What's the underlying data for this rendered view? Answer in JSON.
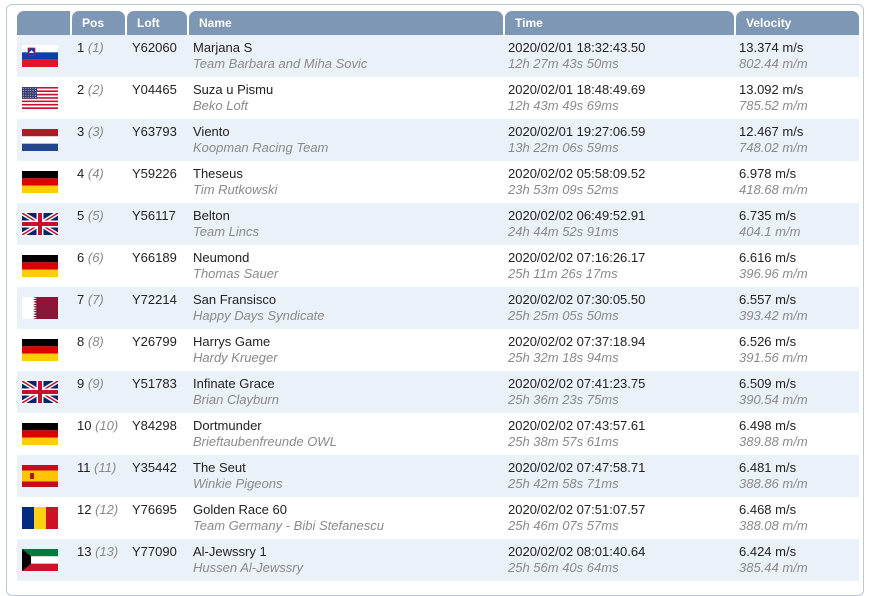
{
  "header": {
    "pos": "Pos",
    "loft": "Loft",
    "name": "Name",
    "time": "Time",
    "velocity": "Velocity"
  },
  "rows": [
    {
      "flag": "slovenia",
      "pos": "1",
      "pos_prev": "(1)",
      "loft": "Y62060",
      "name": "Marjana S",
      "team": "Team Barbara and Miha Sovic",
      "time": "2020/02/01 18:32:43.50",
      "duration": "12h 27m 43s 50ms",
      "velocity": "13.374 m/s",
      "velocity_min": "802.44 m/m"
    },
    {
      "flag": "usa",
      "pos": "2",
      "pos_prev": "(2)",
      "loft": "Y04465",
      "name": "Suza u Pismu",
      "team": "Beko Loft",
      "time": "2020/02/01 18:48:49.69",
      "duration": "12h 43m 49s 69ms",
      "velocity": "13.092 m/s",
      "velocity_min": "785.52 m/m"
    },
    {
      "flag": "netherlands",
      "pos": "3",
      "pos_prev": "(3)",
      "loft": "Y63793",
      "name": "Viento",
      "team": "Koopman Racing Team",
      "time": "2020/02/01 19:27:06.59",
      "duration": "13h 22m 06s 59ms",
      "velocity": "12.467 m/s",
      "velocity_min": "748.02 m/m"
    },
    {
      "flag": "germany",
      "pos": "4",
      "pos_prev": "(4)",
      "loft": "Y59226",
      "name": "Theseus",
      "team": "Tim Rutkowski",
      "time": "2020/02/02 05:58:09.52",
      "duration": "23h 53m 09s 52ms",
      "velocity": "6.978 m/s",
      "velocity_min": "418.68 m/m"
    },
    {
      "flag": "uk",
      "pos": "5",
      "pos_prev": "(5)",
      "loft": "Y56117",
      "name": "Belton",
      "team": "Team Lincs",
      "time": "2020/02/02 06:49:52.91",
      "duration": "24h 44m 52s 91ms",
      "velocity": "6.735 m/s",
      "velocity_min": "404.1 m/m"
    },
    {
      "flag": "germany",
      "pos": "6",
      "pos_prev": "(6)",
      "loft": "Y66189",
      "name": "Neumond",
      "team": "Thomas Sauer",
      "time": "2020/02/02 07:16:26.17",
      "duration": "25h 11m 26s 17ms",
      "velocity": "6.616 m/s",
      "velocity_min": "396.96 m/m"
    },
    {
      "flag": "qatar",
      "pos": "7",
      "pos_prev": "(7)",
      "loft": "Y72214",
      "name": "San Fransisco",
      "team": "Happy Days Syndicate",
      "time": "2020/02/02 07:30:05.50",
      "duration": "25h 25m 05s 50ms",
      "velocity": "6.557 m/s",
      "velocity_min": "393.42 m/m"
    },
    {
      "flag": "germany",
      "pos": "8",
      "pos_prev": "(8)",
      "loft": "Y26799",
      "name": "Harrys Game",
      "team": "Hardy Krueger",
      "time": "2020/02/02 07:37:18.94",
      "duration": "25h 32m 18s 94ms",
      "velocity": "6.526 m/s",
      "velocity_min": "391.56 m/m"
    },
    {
      "flag": "uk",
      "pos": "9",
      "pos_prev": "(9)",
      "loft": "Y51783",
      "name": "Infinate Grace",
      "team": "Brian Clayburn",
      "time": "2020/02/02 07:41:23.75",
      "duration": "25h 36m 23s 75ms",
      "velocity": "6.509 m/s",
      "velocity_min": "390.54 m/m"
    },
    {
      "flag": "germany",
      "pos": "10",
      "pos_prev": "(10)",
      "loft": "Y84298",
      "name": "Dortmunder",
      "team": "Brieftaubenfreunde OWL",
      "time": "2020/02/02 07:43:57.61",
      "duration": "25h 38m 57s 61ms",
      "velocity": "6.498 m/s",
      "velocity_min": "389.88 m/m"
    },
    {
      "flag": "spain",
      "pos": "11",
      "pos_prev": "(11)",
      "loft": "Y35442",
      "name": "The Seut",
      "team": "Winkie Pigeons",
      "time": "2020/02/02 07:47:58.71",
      "duration": "25h 42m 58s 71ms",
      "velocity": "6.481 m/s",
      "velocity_min": "388.86 m/m"
    },
    {
      "flag": "romania",
      "pos": "12",
      "pos_prev": "(12)",
      "loft": "Y76695",
      "name": "Golden Race 60",
      "team": "Team Germany - Bibi Stefanescu",
      "time": "2020/02/02 07:51:07.57",
      "duration": "25h 46m 07s 57ms",
      "velocity": "6.468 m/s",
      "velocity_min": "388.08 m/m"
    },
    {
      "flag": "kuwait",
      "pos": "13",
      "pos_prev": "(13)",
      "loft": "Y77090",
      "name": "Al-Jewssry 1",
      "team": "Hussen Al-Jewssry",
      "time": "2020/02/02 08:01:40.64",
      "duration": "25h 56m 40s 64ms",
      "velocity": "6.424 m/s",
      "velocity_min": "385.44 m/m"
    }
  ],
  "colors": {
    "header_bg": "#7e97b5",
    "row_alt_bg": "#eaf1f8",
    "frame_border": "#b9c9dc",
    "muted_text": "#8a8a8a"
  }
}
